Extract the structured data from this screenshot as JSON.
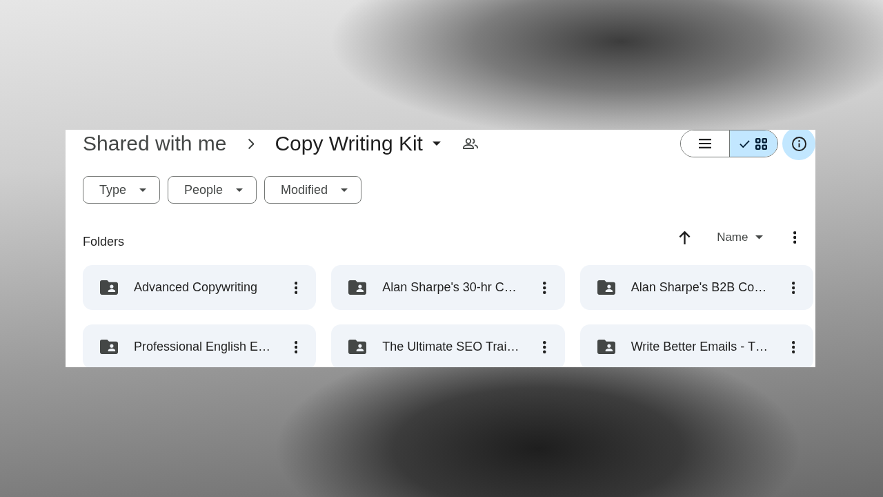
{
  "breadcrumb": [
    {
      "label": "Shared with me",
      "current": false
    },
    {
      "label": "Copy Writing Kit",
      "current": true
    }
  ],
  "view_toggle": [
    {
      "kind": "list",
      "selected": false
    },
    {
      "kind": "grid",
      "selected": true
    }
  ],
  "info_button": {
    "active": true
  },
  "filters": [
    {
      "label": "Type"
    },
    {
      "label": "People"
    },
    {
      "label": "Modified"
    }
  ],
  "section": {
    "title": "Folders"
  },
  "sort": {
    "ascending": true,
    "label": "Name"
  },
  "folders": [
    {
      "name": "Advanced Copywriting"
    },
    {
      "name": "Alan Sharpe's 30-hr C…"
    },
    {
      "name": "Alan Sharpe's B2B Co…"
    },
    {
      "name": "Professional English E…"
    },
    {
      "name": "The Ultimate SEO Trai…"
    },
    {
      "name": "Write Better Emails - T…"
    }
  ]
}
